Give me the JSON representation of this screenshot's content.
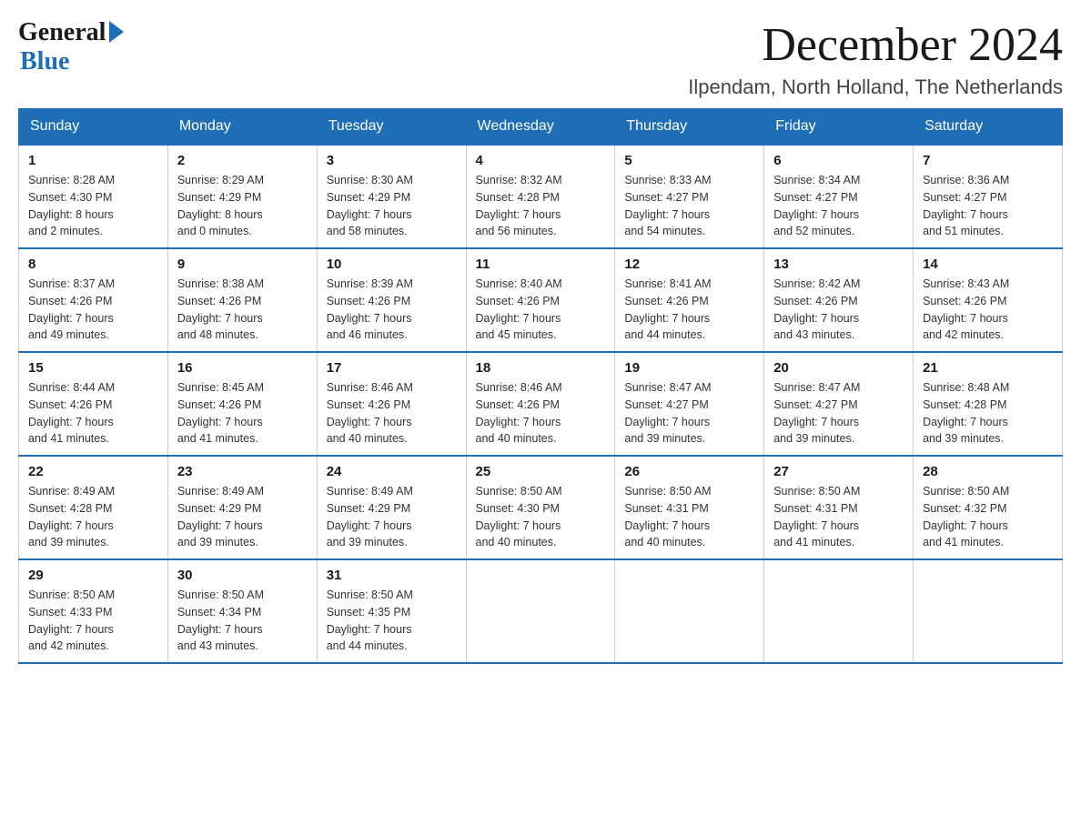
{
  "logo": {
    "general": "General",
    "blue": "Blue"
  },
  "title": "December 2024",
  "location": "Ilpendam, North Holland, The Netherlands",
  "days_of_week": [
    "Sunday",
    "Monday",
    "Tuesday",
    "Wednesday",
    "Thursday",
    "Friday",
    "Saturday"
  ],
  "weeks": [
    [
      {
        "day": "1",
        "sunrise": "8:28 AM",
        "sunset": "4:30 PM",
        "daylight": "8 hours and 2 minutes."
      },
      {
        "day": "2",
        "sunrise": "8:29 AM",
        "sunset": "4:29 PM",
        "daylight": "8 hours and 0 minutes."
      },
      {
        "day": "3",
        "sunrise": "8:30 AM",
        "sunset": "4:29 PM",
        "daylight": "7 hours and 58 minutes."
      },
      {
        "day": "4",
        "sunrise": "8:32 AM",
        "sunset": "4:28 PM",
        "daylight": "7 hours and 56 minutes."
      },
      {
        "day": "5",
        "sunrise": "8:33 AM",
        "sunset": "4:27 PM",
        "daylight": "7 hours and 54 minutes."
      },
      {
        "day": "6",
        "sunrise": "8:34 AM",
        "sunset": "4:27 PM",
        "daylight": "7 hours and 52 minutes."
      },
      {
        "day": "7",
        "sunrise": "8:36 AM",
        "sunset": "4:27 PM",
        "daylight": "7 hours and 51 minutes."
      }
    ],
    [
      {
        "day": "8",
        "sunrise": "8:37 AM",
        "sunset": "4:26 PM",
        "daylight": "7 hours and 49 minutes."
      },
      {
        "day": "9",
        "sunrise": "8:38 AM",
        "sunset": "4:26 PM",
        "daylight": "7 hours and 48 minutes."
      },
      {
        "day": "10",
        "sunrise": "8:39 AM",
        "sunset": "4:26 PM",
        "daylight": "7 hours and 46 minutes."
      },
      {
        "day": "11",
        "sunrise": "8:40 AM",
        "sunset": "4:26 PM",
        "daylight": "7 hours and 45 minutes."
      },
      {
        "day": "12",
        "sunrise": "8:41 AM",
        "sunset": "4:26 PM",
        "daylight": "7 hours and 44 minutes."
      },
      {
        "day": "13",
        "sunrise": "8:42 AM",
        "sunset": "4:26 PM",
        "daylight": "7 hours and 43 minutes."
      },
      {
        "day": "14",
        "sunrise": "8:43 AM",
        "sunset": "4:26 PM",
        "daylight": "7 hours and 42 minutes."
      }
    ],
    [
      {
        "day": "15",
        "sunrise": "8:44 AM",
        "sunset": "4:26 PM",
        "daylight": "7 hours and 41 minutes."
      },
      {
        "day": "16",
        "sunrise": "8:45 AM",
        "sunset": "4:26 PM",
        "daylight": "7 hours and 41 minutes."
      },
      {
        "day": "17",
        "sunrise": "8:46 AM",
        "sunset": "4:26 PM",
        "daylight": "7 hours and 40 minutes."
      },
      {
        "day": "18",
        "sunrise": "8:46 AM",
        "sunset": "4:26 PM",
        "daylight": "7 hours and 40 minutes."
      },
      {
        "day": "19",
        "sunrise": "8:47 AM",
        "sunset": "4:27 PM",
        "daylight": "7 hours and 39 minutes."
      },
      {
        "day": "20",
        "sunrise": "8:47 AM",
        "sunset": "4:27 PM",
        "daylight": "7 hours and 39 minutes."
      },
      {
        "day": "21",
        "sunrise": "8:48 AM",
        "sunset": "4:28 PM",
        "daylight": "7 hours and 39 minutes."
      }
    ],
    [
      {
        "day": "22",
        "sunrise": "8:49 AM",
        "sunset": "4:28 PM",
        "daylight": "7 hours and 39 minutes."
      },
      {
        "day": "23",
        "sunrise": "8:49 AM",
        "sunset": "4:29 PM",
        "daylight": "7 hours and 39 minutes."
      },
      {
        "day": "24",
        "sunrise": "8:49 AM",
        "sunset": "4:29 PM",
        "daylight": "7 hours and 39 minutes."
      },
      {
        "day": "25",
        "sunrise": "8:50 AM",
        "sunset": "4:30 PM",
        "daylight": "7 hours and 40 minutes."
      },
      {
        "day": "26",
        "sunrise": "8:50 AM",
        "sunset": "4:31 PM",
        "daylight": "7 hours and 40 minutes."
      },
      {
        "day": "27",
        "sunrise": "8:50 AM",
        "sunset": "4:31 PM",
        "daylight": "7 hours and 41 minutes."
      },
      {
        "day": "28",
        "sunrise": "8:50 AM",
        "sunset": "4:32 PM",
        "daylight": "7 hours and 41 minutes."
      }
    ],
    [
      {
        "day": "29",
        "sunrise": "8:50 AM",
        "sunset": "4:33 PM",
        "daylight": "7 hours and 42 minutes."
      },
      {
        "day": "30",
        "sunrise": "8:50 AM",
        "sunset": "4:34 PM",
        "daylight": "7 hours and 43 minutes."
      },
      {
        "day": "31",
        "sunrise": "8:50 AM",
        "sunset": "4:35 PM",
        "daylight": "7 hours and 44 minutes."
      },
      null,
      null,
      null,
      null
    ]
  ],
  "labels": {
    "sunrise": "Sunrise:",
    "sunset": "Sunset:",
    "daylight": "Daylight:"
  }
}
